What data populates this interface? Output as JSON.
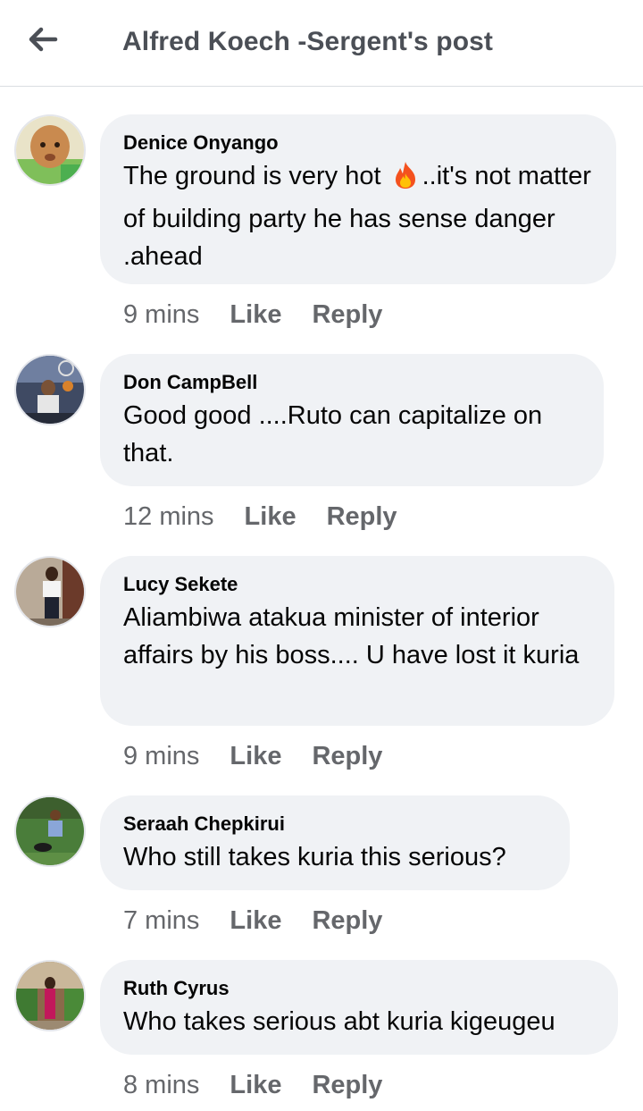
{
  "header": {
    "title": "Alfred Koech -Sergent's post",
    "back_icon": "arrow-left-icon"
  },
  "comments": [
    {
      "author": "Denice Onyango",
      "text_before": "The ground is very hot",
      "emoji": "fire-emoji",
      "text_after": "..it's not matter of building party he has sense danger .ahead",
      "time": "9 mins",
      "like_label": "Like",
      "reply_label": "Reply"
    },
    {
      "author": "Don CampBell",
      "text": "Good good ....Ruto can capitalize on that.",
      "time": "12 mins",
      "like_label": "Like",
      "reply_label": "Reply"
    },
    {
      "author": "Lucy Sekete",
      "text": "Aliambiwa atakua minister of interior affairs by his boss.... U have lost it kuria",
      "time": "9 mins",
      "like_label": "Like",
      "reply_label": "Reply"
    },
    {
      "author": "Seraah Chepkirui",
      "text": "Who still takes kuria this serious?",
      "time": "7 mins",
      "like_label": "Like",
      "reply_label": "Reply"
    },
    {
      "author": "Ruth Cyrus",
      "text": "Who takes serious abt kuria kigeugeu",
      "time": "8 mins",
      "like_label": "Like",
      "reply_label": "Reply"
    }
  ],
  "colors": {
    "bubble": "#f0f2f5",
    "meta_text": "#65676b",
    "header_title": "#4b4f56"
  }
}
